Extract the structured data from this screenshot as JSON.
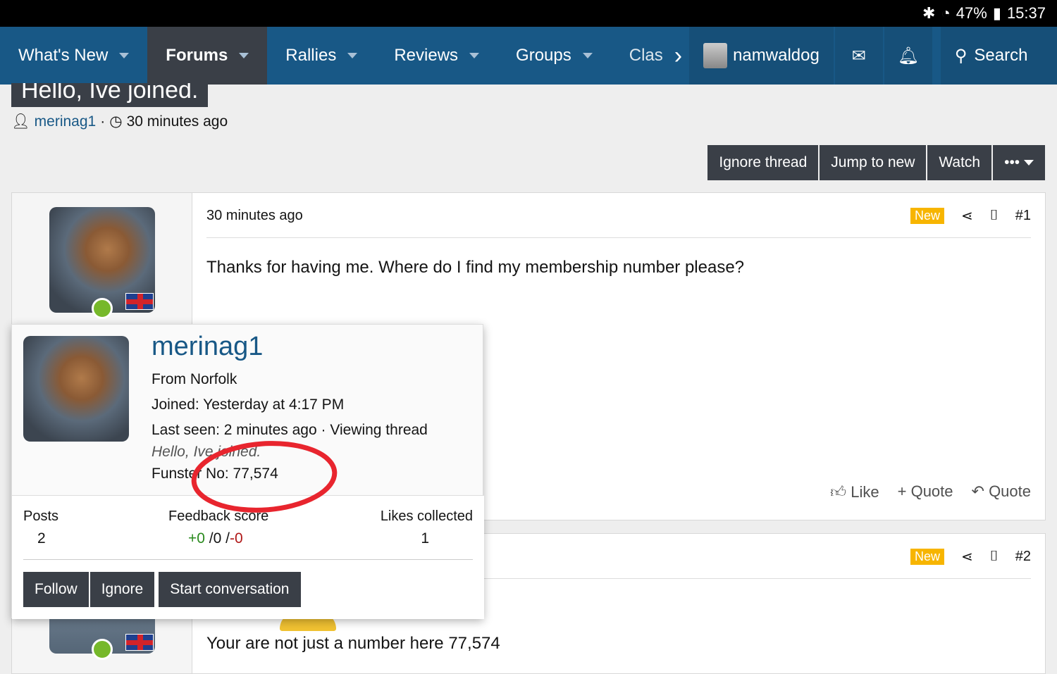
{
  "status_bar": {
    "battery": "47%",
    "time": "15:37"
  },
  "nav": {
    "items": [
      {
        "label": "What's New"
      },
      {
        "label": "Forums"
      },
      {
        "label": "Rallies"
      },
      {
        "label": "Reviews"
      },
      {
        "label": "Groups"
      },
      {
        "label": "Clas"
      }
    ],
    "username": "namwaldog",
    "search": "Search"
  },
  "thread": {
    "title": "Hello, Ive joined.",
    "author": "merinag1",
    "time": "30 minutes ago"
  },
  "actions": {
    "ignore": "Ignore thread",
    "jump": "Jump to new",
    "watch": "Watch",
    "more": "•••"
  },
  "posts": [
    {
      "time": "30 minutes ago",
      "badge": "New",
      "number": "#1",
      "body": "Thanks for having me. Where do I find my membership number please?",
      "like": "Like",
      "multiquote": "+ Quote",
      "quote": "Quote"
    },
    {
      "badge": "New",
      "number": "#2",
      "body": "Your are not just a number here 77,574"
    }
  ],
  "popup": {
    "name": "merinag1",
    "location": "From Norfolk",
    "joined": "Joined: Yesterday at 4:17 PM",
    "last_seen": "Last seen: 2 minutes ago · Viewing thread",
    "activity": "Hello, Ive joined.",
    "funster": "Funster No: 77,574",
    "stats": {
      "posts_label": "Posts",
      "posts": "2",
      "feedback_label": "Feedback score",
      "fb_pos": "+0",
      "fb_neu": " /0 /",
      "fb_neg": "-0",
      "likes_label": "Likes collected",
      "likes": "1"
    },
    "buttons": {
      "follow": "Follow",
      "ignore": "Ignore",
      "conversation": "Start conversation"
    }
  },
  "colors": {
    "nav": "#185886",
    "button": "#3a3f47",
    "badge": "#f7b500",
    "annotation": "#e8252e"
  }
}
